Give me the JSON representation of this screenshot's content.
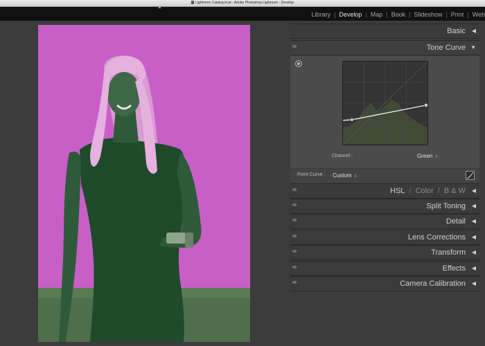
{
  "window": {
    "title": "Lightroom Catalog.lrcat - Adobe Photoshop Lightroom - Develop"
  },
  "modules": [
    {
      "label": "Library",
      "active": false
    },
    {
      "label": "Develop",
      "active": true
    },
    {
      "label": "Map",
      "active": false
    },
    {
      "label": "Book",
      "active": false
    },
    {
      "label": "Slideshow",
      "active": false
    },
    {
      "label": "Print",
      "active": false
    },
    {
      "label": "Web",
      "active": false
    }
  ],
  "panels": {
    "basic": {
      "title": "Basic"
    },
    "tone_curve": {
      "title": "Tone Curve",
      "channel_label": "Channel :",
      "channel_value": "Green",
      "point_curve_label": "Point Curve :",
      "point_curve_value": "Custom"
    },
    "hsl": {
      "hsl": "HSL",
      "sep": "/",
      "color": "Color",
      "bw": "B & W"
    },
    "split_toning": {
      "title": "Split Toning"
    },
    "detail": {
      "title": "Detail"
    },
    "lens_corrections": {
      "title": "Lens Corrections"
    },
    "transform": {
      "title": "Transform"
    },
    "effects": {
      "title": "Effects"
    },
    "camera_calibration": {
      "title": "Camera Calibration"
    }
  },
  "icons": {
    "collapsed": "◀",
    "expanded": "▼",
    "updown": "⇕"
  },
  "colors": {
    "photo_magenta": "#c85fc7",
    "photo_green": "#1f4a2c",
    "curve_line": "#e8e8e8"
  }
}
